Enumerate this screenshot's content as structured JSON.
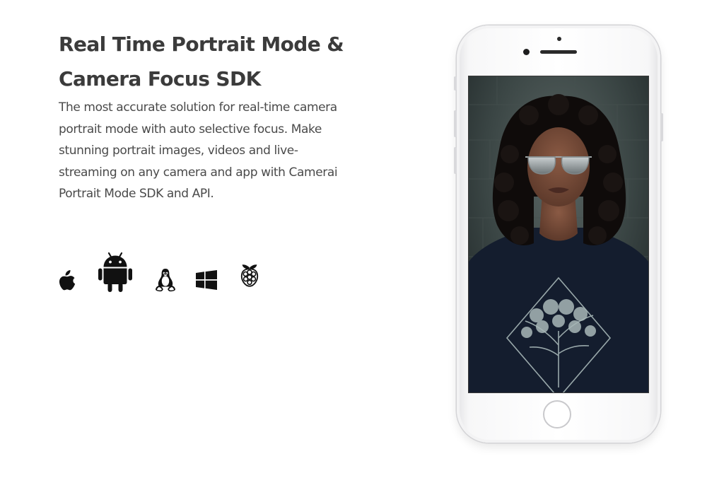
{
  "headline": {
    "line1": "Real Time Portrait Mode &",
    "line2": "Camera Focus SDK"
  },
  "description": {
    "line1": "The most accurate solution for real-time camera",
    "line2": "portrait mode with auto selective focus. Make",
    "line3": "stunning portrait images, videos and live-",
    "line4": "streaming on any camera and app with Camerai",
    "line5": "Portrait Mode SDK and API."
  },
  "platforms": [
    {
      "icon": "apple-icon"
    },
    {
      "icon": "android-icon"
    },
    {
      "icon": "linux-icon"
    },
    {
      "icon": "windows-icon"
    },
    {
      "icon": "raspberry-pi-icon"
    }
  ],
  "colors": {
    "heading": "#3b3b3b",
    "body_text": "#4a4a4a",
    "icon": "#111111",
    "background": "#ffffff",
    "phone_body": "#f7f7f8"
  }
}
